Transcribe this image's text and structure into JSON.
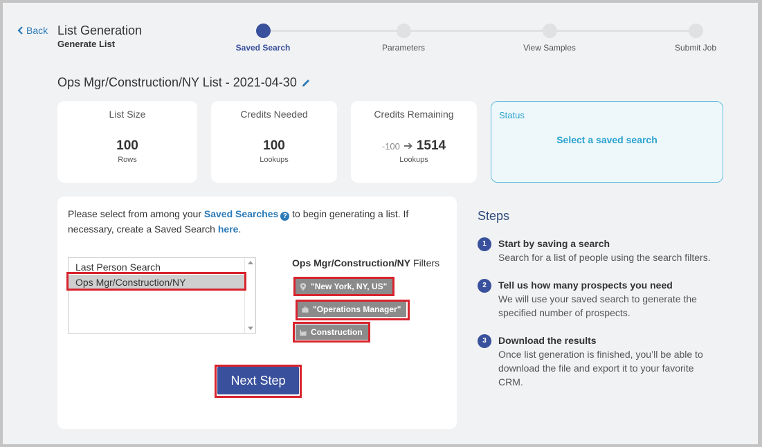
{
  "header": {
    "back_label": "Back",
    "title": "List Generation",
    "subtitle": "Generate List"
  },
  "wizard": {
    "steps": [
      {
        "label": "Saved Search",
        "active": true
      },
      {
        "label": "Parameters",
        "active": false
      },
      {
        "label": "View Samples",
        "active": false
      },
      {
        "label": "Submit Job",
        "active": false
      }
    ]
  },
  "list_name": "Ops Mgr/Construction/NY List - 2021-04-30",
  "stats": {
    "list_size": {
      "caption": "List Size",
      "value": "100",
      "unit": "Rows"
    },
    "credits_needed": {
      "caption": "Credits Needed",
      "value": "100",
      "unit": "Lookups"
    },
    "credits_remaining": {
      "caption": "Credits Remaining",
      "delta": "-100",
      "value": "1514",
      "unit": "Lookups"
    },
    "status": {
      "caption": "Status",
      "value": "Select a saved search"
    }
  },
  "selection": {
    "intro_before": "Please select from among your ",
    "saved_searches_link": "Saved Searches",
    "intro_middle": " to begin generating a list. If necessary, create a Saved Search ",
    "here_link": "here",
    "intro_end": ".",
    "saved_searches": [
      "Last Person Search",
      "Ops Mgr/Construction/NY"
    ],
    "selected_index": 1,
    "filters_name": "Ops Mgr/Construction/NY",
    "filters_suffix": " Filters",
    "filters": [
      {
        "label": "\"New York, NY, US\"",
        "icon": "location-pin-icon"
      },
      {
        "label": "\"Operations Manager\"",
        "icon": "briefcase-icon"
      },
      {
        "label": "Construction",
        "icon": "factory-icon"
      }
    ],
    "next_label": "Next Step"
  },
  "guide": {
    "title": "Steps",
    "items": [
      {
        "num": "1",
        "head": "Start by saving a search",
        "desc": "Search for a list of people using the search filters."
      },
      {
        "num": "2",
        "head": "Tell us how many prospects you need",
        "desc": "We will use your saved search to generate the specified number of prospects."
      },
      {
        "num": "3",
        "head": "Download the results",
        "desc": "Once list generation is finished, you’ll be able to download the file and export it to your favorite CRM."
      }
    ]
  },
  "colors": {
    "primary": "#39509c",
    "link": "#2a7ab8",
    "status_accent": "#29a3d0",
    "highlight": "#d7232d",
    "chip_bg": "#8b8b8b"
  }
}
